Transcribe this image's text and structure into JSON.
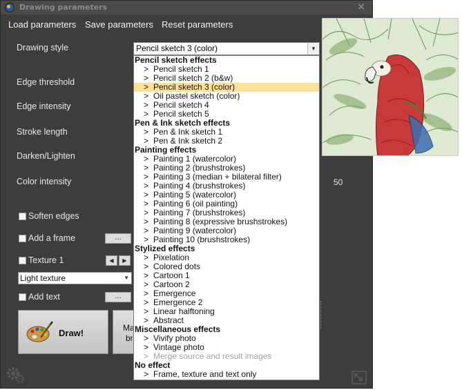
{
  "window": {
    "title": "Drawing parameters",
    "close_glyph": "×"
  },
  "menu": {
    "load": "Load parameters",
    "save": "Save parameters",
    "reset": "Reset parameters"
  },
  "labels": {
    "drawing_style": "Drawing style",
    "edge_threshold": "Edge threshold",
    "edge_intensity": "Edge intensity",
    "stroke_length": "Stroke length",
    "darken_lighten": "Darken/Lighten",
    "color_intensity": "Color intensity",
    "soften_edges": "Soften edges",
    "add_frame": "Add a frame",
    "texture": "Texture 1",
    "add_text": "Add text"
  },
  "values": {
    "color_intensity": "50"
  },
  "drawing_style": {
    "selected": "Pencil sketch 3 (color)",
    "groups": [
      {
        "name": "Pencil sketch effects",
        "items": [
          {
            "label": "Pencil sketch 1"
          },
          {
            "label": "Pencil sketch 2 (b&w)"
          },
          {
            "label": "Pencil sketch 3 (color)",
            "selected": true
          },
          {
            "label": "Oil pastel sketch (color)"
          },
          {
            "label": "Pencil sketch 4"
          },
          {
            "label": "Pencil sketch 5"
          }
        ]
      },
      {
        "name": "Pen & Ink sketch effects",
        "items": [
          {
            "label": "Pen & Ink sketch 1"
          },
          {
            "label": "Pen & Ink sketch 2"
          }
        ]
      },
      {
        "name": "Painting effects",
        "items": [
          {
            "label": "Painting 1 (watercolor)"
          },
          {
            "label": "Painting 2 (brushstrokes)"
          },
          {
            "label": "Painting 3 (median + bilateral filter)"
          },
          {
            "label": "Painting 4 (brushstrokes)"
          },
          {
            "label": "Painting 5 (watercolor)"
          },
          {
            "label": "Painting 6 (oil painting)"
          },
          {
            "label": "Painting 7 (brushstrokes)"
          },
          {
            "label": "Painting 8 (expressive brushstrokes)"
          },
          {
            "label": "Painting 9 (watercolor)"
          },
          {
            "label": "Painting 10 (brushstrokes)"
          }
        ]
      },
      {
        "name": "Stylized effects",
        "items": [
          {
            "label": "Pixelation"
          },
          {
            "label": "Colored dots"
          },
          {
            "label": "Cartoon 1"
          },
          {
            "label": "Cartoon 2"
          },
          {
            "label": "Emergence"
          },
          {
            "label": "Emergence 2"
          },
          {
            "label": "Linear halftoning"
          },
          {
            "label": "Abstract"
          }
        ]
      },
      {
        "name": "Miscellaneous effects",
        "items": [
          {
            "label": "Vivify photo"
          },
          {
            "label": "Vintage photo"
          },
          {
            "label": "Merge source and result images",
            "disabled": true
          }
        ]
      },
      {
        "name": "No effect",
        "items": [
          {
            "label": "Frame, texture and text only"
          }
        ]
      }
    ]
  },
  "texture": {
    "selected": "Light texture"
  },
  "buttons": {
    "ellipsis": "...",
    "draw": "Draw!",
    "second_line1": "Ma",
    "second_line2": "br"
  },
  "icons": {
    "gear": "gear-icon",
    "palette": "palette-icon",
    "resize": "resize-icon",
    "prev": "◀",
    "next": "▶"
  },
  "colors": {
    "window_bg": "#3d3d3d",
    "selection": "#f9e09c"
  }
}
